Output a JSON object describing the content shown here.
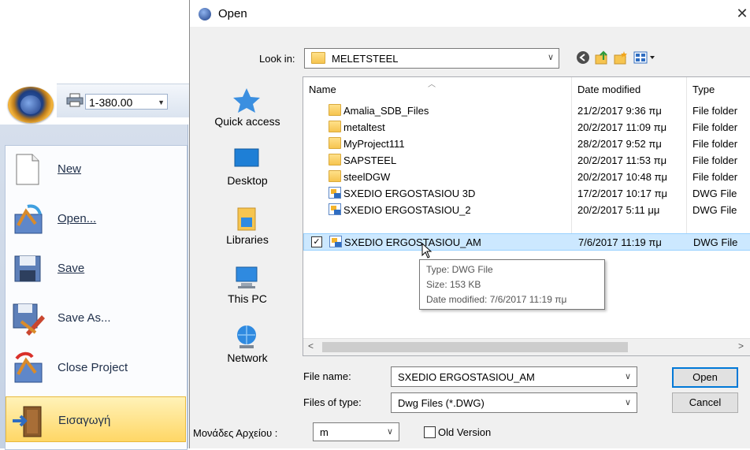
{
  "app": {
    "zoom_value": "1-380.00",
    "menu": [
      {
        "label": "New",
        "icon": "new-document-icon"
      },
      {
        "label": "Open...",
        "icon": "open-project-icon"
      },
      {
        "label": "Save",
        "icon": "save-icon"
      },
      {
        "label": "Save As...",
        "icon": "save-as-icon"
      },
      {
        "label": "Close Project",
        "icon": "close-project-icon"
      },
      {
        "label": "Εισαγωγή",
        "icon": "import-door-icon"
      }
    ]
  },
  "dialog": {
    "title": "Open",
    "close_glyph": "✕",
    "look_in_label": "Look in:",
    "look_in_value": "MELETSTEEL",
    "places": [
      {
        "label": "Quick access",
        "icon": "quick-access-star-icon"
      },
      {
        "label": "Desktop",
        "icon": "desktop-icon"
      },
      {
        "label": "Libraries",
        "icon": "libraries-icon"
      },
      {
        "label": "This PC",
        "icon": "this-pc-icon"
      },
      {
        "label": "Network",
        "icon": "network-icon"
      }
    ],
    "columns": {
      "name": "Name",
      "date": "Date modified",
      "type": "Type"
    },
    "files": [
      {
        "name": "Amalia_SDB_Files",
        "date": "21/2/2017 9:36 πμ",
        "type": "File folder",
        "kind": "folder"
      },
      {
        "name": "metaltest",
        "date": "20/2/2017 11:09 πμ",
        "type": "File folder",
        "kind": "folder"
      },
      {
        "name": "MyProject111",
        "date": "28/2/2017 9:52 πμ",
        "type": "File folder",
        "kind": "folder"
      },
      {
        "name": "SAPSTEEL",
        "date": "20/2/2017 11:53 πμ",
        "type": "File folder",
        "kind": "folder"
      },
      {
        "name": "steelDGW",
        "date": "20/2/2017 10:48 πμ",
        "type": "File folder",
        "kind": "folder"
      },
      {
        "name": "SXEDIO ERGOSTASIOU 3D",
        "date": "17/2/2017 10:17 πμ",
        "type": "DWG File",
        "kind": "dwg"
      },
      {
        "name": "SXEDIO ERGOSTASIOU_2",
        "date": "20/2/2017 5:11 μμ",
        "type": "DWG File",
        "kind": "dwg"
      },
      {
        "name": "SXEDIO ERGOSTASIOU_AM",
        "date": "7/6/2017 11:19 πμ",
        "type": "DWG File",
        "kind": "dwg",
        "selected": true
      }
    ],
    "tooltip": {
      "type": "Type: DWG File",
      "size": "Size: 153 KB",
      "modified": "Date modified: 7/6/2017 11:19 πμ"
    },
    "file_name_label": "File name:",
    "file_name_value": "SXEDIO ERGOSTASIOU_AM",
    "file_type_label": "Files of type:",
    "file_type_value": "Dwg Files (*.DWG)",
    "open_label": "Open",
    "cancel_label": "Cancel",
    "units_label": "Μονάδες Αρχείου :",
    "units_value": "m",
    "old_version_label": "Old Version"
  }
}
